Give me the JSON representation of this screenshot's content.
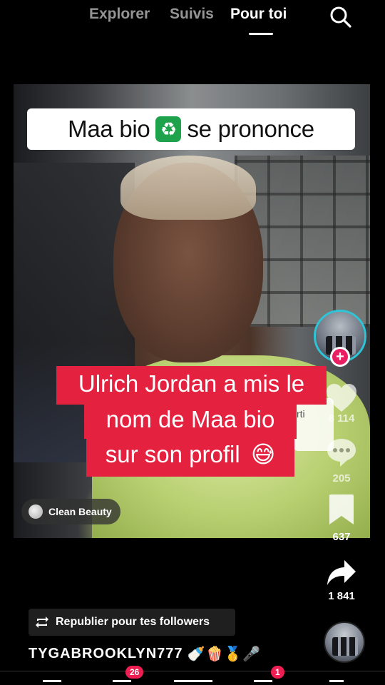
{
  "top_nav": {
    "tabs": [
      {
        "label": "Explorer"
      },
      {
        "label": "Suivis"
      },
      {
        "label": "Pour toi"
      }
    ],
    "active_tab": "Pour toi",
    "search_icon": "search-icon"
  },
  "video": {
    "top_caption": {
      "before": "Maa bio",
      "emoji": "♻️",
      "after": "se prononce"
    },
    "red_caption": {
      "line1": "Ulrich Jordan a mis le",
      "line2": "nom de Maa bio",
      "line3": "sur son profil",
      "line3_emoji": "😅"
    },
    "ghost_card_text": "rti",
    "tag_label": "Clean Beauty"
  },
  "rail": {
    "likes": "8 114",
    "comments": "205",
    "saves": "637",
    "shares": "1 841",
    "follow_symbol": "+"
  },
  "repost": {
    "label": "Republier pour tes followers"
  },
  "author": {
    "username": "TYGABROOKLYN777",
    "emojis": "🍼🍿🥇🎤"
  },
  "bottom_bar": {
    "badge_inbox": "26",
    "badge_messages": "1"
  },
  "colors": {
    "accent_red": "#e4213f",
    "follow_pink": "#e91e63",
    "avatar_ring": "#2ec4d6",
    "recycle_green": "#1ea34c"
  }
}
